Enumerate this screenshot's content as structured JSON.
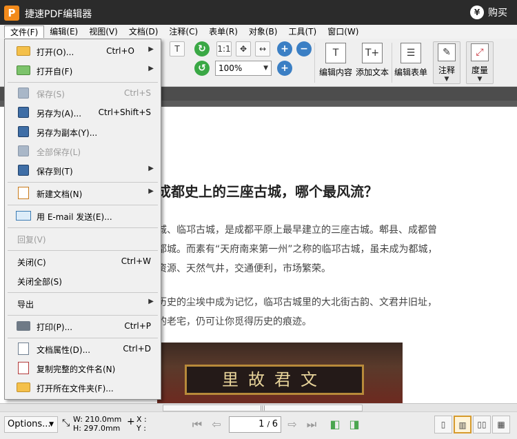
{
  "app": {
    "logo": "P",
    "title": "捷速PDF编辑器",
    "buy_icon": "¥",
    "buy_label": "购买"
  },
  "menubar": [
    {
      "label": "文件(F)",
      "active": true
    },
    {
      "label": "编辑(E)"
    },
    {
      "label": "视图(V)"
    },
    {
      "label": "文档(D)"
    },
    {
      "label": "注释(C)"
    },
    {
      "label": "表单(R)"
    },
    {
      "label": "对象(B)"
    },
    {
      "label": "工具(T)"
    },
    {
      "label": "窗口(W)"
    }
  ],
  "toolbar": {
    "zoom_value": "100%",
    "edit_content": "编辑内容",
    "add_text": "添加文本",
    "edit_form": "编辑表单",
    "annotate": "注释",
    "measure": "度量"
  },
  "filemenu": [
    {
      "label": "打开(O)...",
      "shortcut": "Ctrl+O",
      "submenu": true,
      "icon": "folder-open-icon"
    },
    {
      "label": "打开自(F)",
      "shortcut": "",
      "submenu": true,
      "icon": "folder-open-from-icon"
    },
    {
      "label": "保存(S)",
      "shortcut": "Ctrl+S",
      "disabled": true,
      "icon": "save-icon"
    },
    {
      "label": "另存为(A)...",
      "shortcut": "Ctrl+Shift+S",
      "icon": "save-as-icon"
    },
    {
      "label": "另存为副本(Y)...",
      "shortcut": "",
      "icon": "save-copy-icon"
    },
    {
      "label": "全部保存(L)",
      "shortcut": "",
      "disabled": true,
      "icon": "save-all-icon"
    },
    {
      "label": "保存到(T)",
      "shortcut": "",
      "submenu": true,
      "icon": "save-to-icon"
    },
    {
      "label": "新建文档(N)",
      "shortcut": "",
      "submenu": true,
      "icon": "new-document-icon"
    },
    {
      "label": "用 E-mail 发送(E)...",
      "shortcut": "",
      "icon": "email-icon"
    },
    {
      "label": "回复(V)",
      "shortcut": "",
      "disabled": true
    },
    {
      "label": "关闭(C)",
      "shortcut": "Ctrl+W"
    },
    {
      "label": "关闭全部(S)",
      "shortcut": ""
    },
    {
      "label": "导出",
      "shortcut": "",
      "submenu": true
    },
    {
      "label": "打印(P)...",
      "shortcut": "Ctrl+P",
      "icon": "printer-icon"
    },
    {
      "label": "文档属性(D)...",
      "shortcut": "Ctrl+D",
      "icon": "document-properties-icon"
    },
    {
      "label": "复制完整的文件名(N)",
      "shortcut": "",
      "icon": "copy-filename-icon"
    },
    {
      "label": "打开所在文件夹(F)...",
      "shortcut": "",
      "icon": "open-folder-icon"
    }
  ],
  "document": {
    "title": "成都史上的三座古城，哪个最风流？",
    "lines": [
      "城、临邛古城，是成都平原上最早建立的三座古城。郫县、成都曾",
      "都城。而素有“天府南来第一州”之称的临邛古城，虽未成为都城，",
      "资源、天然气井，交通便利，市场繁荣。",
      "历史的尘埃中成为记忆，临邛古城里的大北街古韵、文君井旧址，",
      "的老宅，仍可让你觅得历史的痕迹。"
    ],
    "sign_text": "里故君文"
  },
  "status": {
    "options_label": "Options...",
    "width": "W: 210.0mm",
    "height": "H: 297.0mm",
    "x_label": "X :",
    "y_label": "Y :",
    "page_current": "1",
    "page_total": "6",
    "page_display": "1 / 6"
  },
  "colors": {
    "titlebar": "#2b2b2b",
    "accent": "#f28a1b",
    "selected_view": "#d69a2b"
  }
}
